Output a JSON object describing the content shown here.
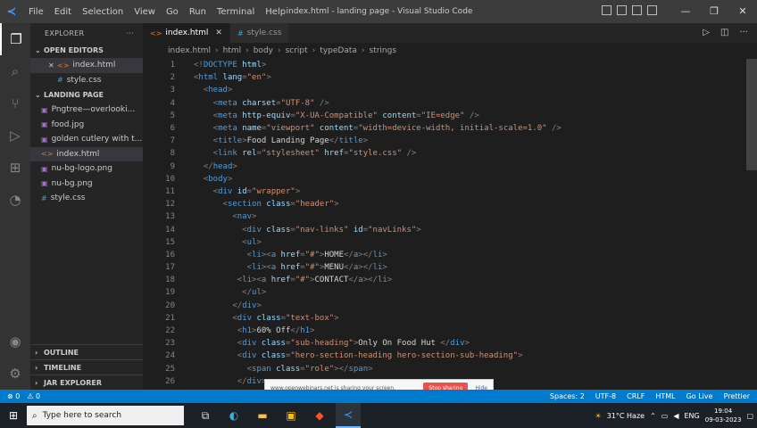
{
  "titlebar": {
    "menu": [
      "File",
      "Edit",
      "Selection",
      "View",
      "Go",
      "Run",
      "Terminal",
      "Help"
    ],
    "title": "index.html - landing page - Visual Studio Code"
  },
  "sidebar": {
    "header": "EXPLORER",
    "open_editors_title": "OPEN EDITORS",
    "open_editors": [
      "index.html",
      "style.css"
    ],
    "folder_title": "LANDING PAGE",
    "files": [
      "Pngtree—overlooki...",
      "food.jpg",
      "golden cutlery with t...",
      "index.html",
      "nu-bg-logo.png",
      "nu-bg.png",
      "style.css"
    ],
    "outline": "OUTLINE",
    "timeline": "TIMELINE",
    "jar": "JAR EXPLORER"
  },
  "tabs": [
    {
      "label": "index.html"
    },
    {
      "label": "style.css"
    }
  ],
  "breadcrumb": [
    "index.html",
    "html",
    "body",
    "script",
    "typeData",
    "strings"
  ],
  "code": {
    "lines": [
      [
        [
          "p",
          "<!"
        ],
        [
          "t",
          "DOCTYPE"
        ],
        [
          "a",
          " html"
        ],
        [
          "p",
          ">"
        ]
      ],
      [
        [
          "p",
          "<"
        ],
        [
          "t",
          "html"
        ],
        [
          "a",
          " lang"
        ],
        [
          "p",
          "="
        ],
        [
          "s",
          "\"en\""
        ],
        [
          "p",
          ">"
        ]
      ],
      [
        [
          "p",
          "  <"
        ],
        [
          "t",
          "head"
        ],
        [
          "p",
          ">"
        ]
      ],
      [
        [
          "p",
          "    <"
        ],
        [
          "t",
          "meta"
        ],
        [
          "a",
          " charset"
        ],
        [
          "p",
          "="
        ],
        [
          "s",
          "\"UTF-8\""
        ],
        [
          "p",
          " />"
        ]
      ],
      [
        [
          "p",
          "    <"
        ],
        [
          "t",
          "meta"
        ],
        [
          "a",
          " http-equiv"
        ],
        [
          "p",
          "="
        ],
        [
          "s",
          "\"X-UA-Compatible\""
        ],
        [
          "a",
          " content"
        ],
        [
          "p",
          "="
        ],
        [
          "s",
          "\"IE=edge\""
        ],
        [
          "p",
          " />"
        ]
      ],
      [
        [
          "p",
          "    <"
        ],
        [
          "t",
          "meta"
        ],
        [
          "a",
          " name"
        ],
        [
          "p",
          "="
        ],
        [
          "s",
          "\"viewport\""
        ],
        [
          "a",
          " content"
        ],
        [
          "p",
          "="
        ],
        [
          "s",
          "\"width=device-width, initial-scale=1.0\""
        ],
        [
          "p",
          " />"
        ]
      ],
      [
        [
          "p",
          "    <"
        ],
        [
          "t",
          "title"
        ],
        [
          "p",
          ">"
        ],
        [
          "x",
          "Food Landing Page"
        ],
        [
          "p",
          "</"
        ],
        [
          "t",
          "title"
        ],
        [
          "p",
          ">"
        ]
      ],
      [
        [
          "p",
          "    <"
        ],
        [
          "t",
          "link"
        ],
        [
          "a",
          " rel"
        ],
        [
          "p",
          "="
        ],
        [
          "s",
          "\"stylesheet\""
        ],
        [
          "a",
          " href"
        ],
        [
          "p",
          "="
        ],
        [
          "s",
          "\"style.css\""
        ],
        [
          "p",
          " />"
        ]
      ],
      [
        [
          "p",
          "  </"
        ],
        [
          "t",
          "head"
        ],
        [
          "p",
          ">"
        ]
      ],
      [
        [
          "p",
          "  <"
        ],
        [
          "t",
          "body"
        ],
        [
          "p",
          ">"
        ]
      ],
      [
        [
          "p",
          "    <"
        ],
        [
          "t",
          "div"
        ],
        [
          "a",
          " id"
        ],
        [
          "p",
          "="
        ],
        [
          "s",
          "\"wrapper\""
        ],
        [
          "p",
          ">"
        ]
      ],
      [
        [
          "p",
          "      <"
        ],
        [
          "t",
          "section"
        ],
        [
          "a",
          " class"
        ],
        [
          "p",
          "="
        ],
        [
          "s",
          "\"header\""
        ],
        [
          "p",
          ">"
        ]
      ],
      [
        [
          "p",
          "        <"
        ],
        [
          "t",
          "nav"
        ],
        [
          "p",
          ">"
        ]
      ],
      [
        [
          "p",
          "          <"
        ],
        [
          "t",
          "div"
        ],
        [
          "a",
          " class"
        ],
        [
          "p",
          "="
        ],
        [
          "s",
          "\"nav-links\""
        ],
        [
          "a",
          " id"
        ],
        [
          "p",
          "="
        ],
        [
          "s",
          "\"navLinks\""
        ],
        [
          "p",
          ">"
        ]
      ],
      [
        [
          "p",
          "          <"
        ],
        [
          "t",
          "ul"
        ],
        [
          "p",
          ">"
        ]
      ],
      [
        [
          "p",
          "           <"
        ],
        [
          "t",
          "li"
        ],
        [
          "p",
          "><"
        ],
        [
          "t",
          "a"
        ],
        [
          "a",
          " href"
        ],
        [
          "p",
          "="
        ],
        [
          "s",
          "\"#\""
        ],
        [
          "p",
          ">"
        ],
        [
          "x",
          "HOME"
        ],
        [
          "p",
          "</"
        ],
        [
          "t",
          "a"
        ],
        [
          "p",
          "></"
        ],
        [
          "t",
          "li"
        ],
        [
          "p",
          ">"
        ]
      ],
      [
        [
          "p",
          "           <"
        ],
        [
          "t",
          "li"
        ],
        [
          "p",
          "><"
        ],
        [
          "t",
          "a"
        ],
        [
          "a",
          " href"
        ],
        [
          "p",
          "="
        ],
        [
          "s",
          "\"#\""
        ],
        [
          "p",
          ">"
        ],
        [
          "x",
          "MENU"
        ],
        [
          "p",
          "</"
        ],
        [
          "t",
          "a"
        ],
        [
          "p",
          "></"
        ],
        [
          "t",
          "li"
        ],
        [
          "p",
          ">"
        ]
      ],
      [
        [
          "p",
          "         <"
        ],
        [
          "t",
          "li"
        ],
        [
          "p",
          "><"
        ],
        [
          "t",
          "a"
        ],
        [
          "a",
          " href"
        ],
        [
          "p",
          "="
        ],
        [
          "s",
          "\"#\""
        ],
        [
          "p",
          ">"
        ],
        [
          "x",
          "CONTACT"
        ],
        [
          "p",
          "</"
        ],
        [
          "t",
          "a"
        ],
        [
          "p",
          "></"
        ],
        [
          "t",
          "li"
        ],
        [
          "p",
          ">"
        ]
      ],
      [
        [
          "p",
          "          </"
        ],
        [
          "t",
          "ul"
        ],
        [
          "p",
          ">"
        ]
      ],
      [
        [
          "p",
          "        </"
        ],
        [
          "t",
          "div"
        ],
        [
          "p",
          ">"
        ]
      ],
      [
        [
          "p",
          "        <"
        ],
        [
          "t",
          "div"
        ],
        [
          "a",
          " class"
        ],
        [
          "p",
          "="
        ],
        [
          "s",
          "\"text-box\""
        ],
        [
          "p",
          ">"
        ]
      ],
      [
        [
          "p",
          "         <"
        ],
        [
          "t",
          "h1"
        ],
        [
          "p",
          ">"
        ],
        [
          "x",
          "60% Off"
        ],
        [
          "p",
          "</"
        ],
        [
          "t",
          "h1"
        ],
        [
          "p",
          ">"
        ]
      ],
      [
        [
          "p",
          "         <"
        ],
        [
          "t",
          "div"
        ],
        [
          "a",
          " class"
        ],
        [
          "p",
          "="
        ],
        [
          "s",
          "\"sub-heading\""
        ],
        [
          "p",
          ">"
        ],
        [
          "x",
          "Only On Food Hut "
        ],
        [
          "p",
          "</"
        ],
        [
          "t",
          "div"
        ],
        [
          "p",
          ">"
        ]
      ],
      [
        [
          "p",
          "         <"
        ],
        [
          "t",
          "div"
        ],
        [
          "a",
          " class"
        ],
        [
          "p",
          "="
        ],
        [
          "s",
          "\"hero-section-heading hero-section-sub-heading\""
        ],
        [
          "p",
          ">"
        ]
      ],
      [
        [
          "p",
          "           <"
        ],
        [
          "t",
          "span"
        ],
        [
          "a",
          " class"
        ],
        [
          "p",
          "="
        ],
        [
          "s",
          "\"role\""
        ],
        [
          "p",
          "></"
        ],
        [
          "t",
          "span"
        ],
        [
          "p",
          ">"
        ]
      ],
      [
        [
          "p",
          "         </"
        ],
        [
          "t",
          "div"
        ],
        [
          "p",
          ">"
        ]
      ]
    ]
  },
  "share_banner": {
    "message": "www.openwebinars.net is sharing your screen.",
    "stop": "Stop sharing",
    "hide": "Hide"
  },
  "status": {
    "left": [
      "⊗ 0",
      "⚠ 0"
    ],
    "right": [
      "Spaces: 2",
      "UTF-8",
      "CRLF",
      "HTML",
      "Go Live",
      "Prettier"
    ]
  },
  "taskbar": {
    "search_placeholder": "Type here to search",
    "weather": "31°C  Haze",
    "lang": "ENG",
    "time": "19:04",
    "date": "09-03-2023"
  }
}
